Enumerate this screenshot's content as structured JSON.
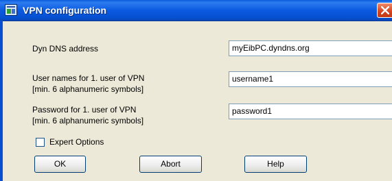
{
  "window": {
    "title": "VPN configuration"
  },
  "form": {
    "dyn_dns": {
      "label": "Dyn DNS address",
      "value": "myEibPC.dyndns.org"
    },
    "username": {
      "label_line1": "User names for 1. user of VPN",
      "label_line2": "[min. 6 alphanumeric symbols]",
      "value": "username1"
    },
    "password": {
      "label_line1": "Password for 1. user of VPN",
      "label_line2": "[min. 6 alphanumeric symbols]",
      "value": "password1"
    },
    "expert_options": {
      "label": "Expert Options",
      "checked": false
    }
  },
  "buttons": {
    "ok": "OK",
    "abort": "Abort",
    "help": "Help"
  },
  "colors": {
    "titlebar": "#0a5bdc",
    "dialog_bg": "#ece9d8",
    "close_button": "#d5431f",
    "field_border": "#7f9db9"
  }
}
